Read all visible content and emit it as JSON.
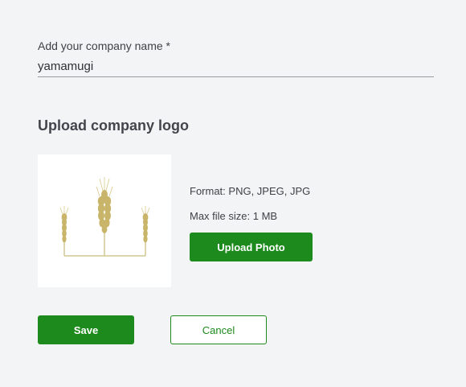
{
  "company_name": {
    "label": "Add your company name *",
    "value": "yamamugi"
  },
  "logo_section": {
    "title": "Upload company logo",
    "logo_image": "wheat-stalks-logo",
    "format_text": "Format: PNG, JPEG, JPG",
    "max_size_text": "Max file size: 1 MB",
    "upload_label": "Upload Photo"
  },
  "actions": {
    "save_label": "Save",
    "cancel_label": "Cancel"
  },
  "colors": {
    "primary": "#1c8a1c",
    "background": "#f3f4f6",
    "wheat": "#c9b56a"
  }
}
